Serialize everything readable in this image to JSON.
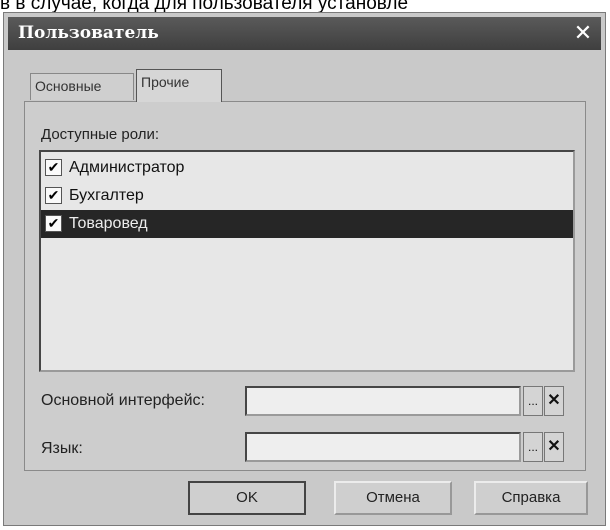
{
  "caption": "в в случае, когда для пользователя установле",
  "window": {
    "title": "Пользователь",
    "close_glyph": "✕"
  },
  "tabs": [
    {
      "label": "Основные",
      "active": false
    },
    {
      "label": "Прочие",
      "active": true
    }
  ],
  "roles": {
    "label": "Доступные роли:",
    "items": [
      {
        "label": "Администратор",
        "checked": true,
        "selected": false
      },
      {
        "label": "Бухгалтер",
        "checked": true,
        "selected": false
      },
      {
        "label": "Товаровед",
        "checked": true,
        "selected": true
      }
    ]
  },
  "fields": {
    "interface": {
      "label": "Основной интерфейс:",
      "value": ""
    },
    "language": {
      "label": "Язык:",
      "value": ""
    },
    "choose_glyph": "...",
    "clear_glyph": "✕"
  },
  "buttons": {
    "ok": "OK",
    "cancel": "Отмена",
    "help": "Справка"
  },
  "icons": {
    "check": "✔"
  }
}
